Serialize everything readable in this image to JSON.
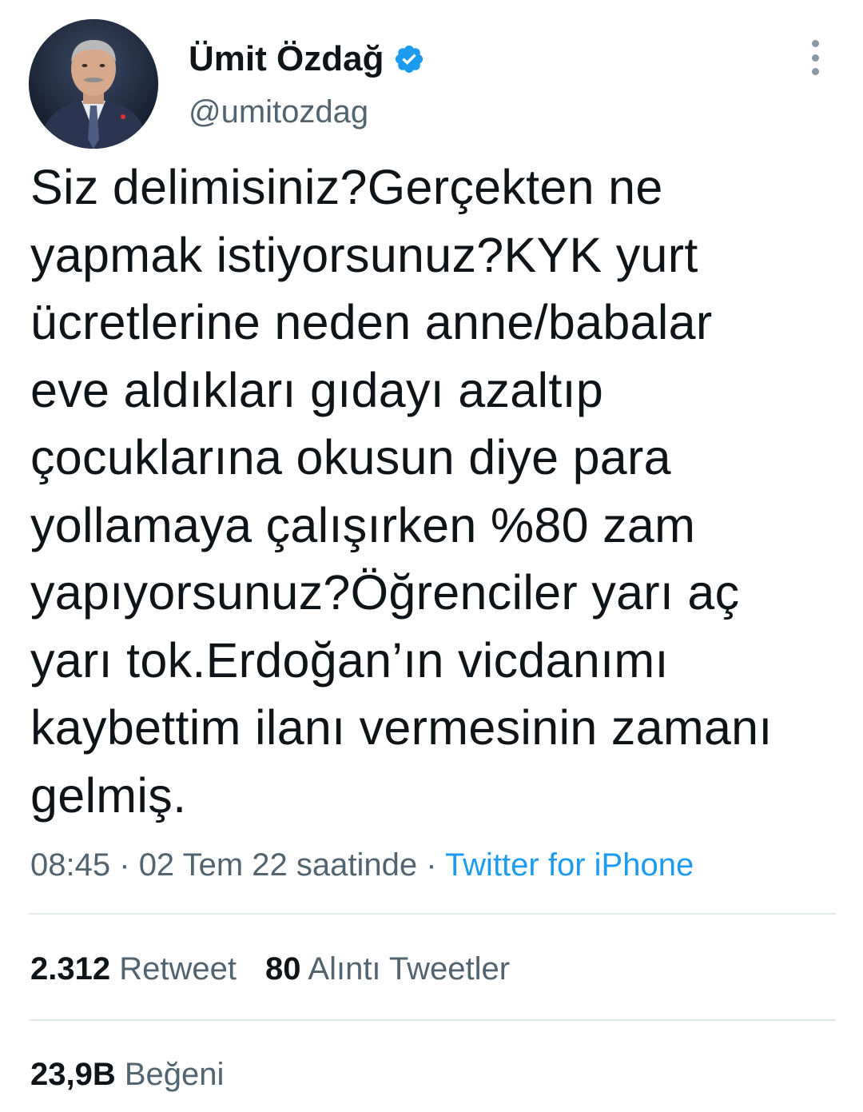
{
  "author": {
    "name": "Ümit Özdağ",
    "handle": "@umitozdag",
    "verified": true,
    "avatar_icon": "profile-photo"
  },
  "tweet": {
    "text": "Siz delimisiniz?Gerçekten ne\nyapmak istiyorsunuz?KYK yurt\nücretlerine neden anne/babalar\neve aldıkları gıdayı azaltıp\nçocuklarına okusun diye para\nyollamaya çalışırken %80 zam\nyapıyorsunuz?Öğrenciler yarı aç\nyarı tok.Erdoğan’ın vicdanımı\nkaybettim ilanı vermesinin zamanı\ngelmiş.",
    "time": "08:45",
    "date": "02 Tem 22 saatinde",
    "separator": "·",
    "source": "Twitter for iPhone"
  },
  "stats": {
    "retweets_count": "2.312",
    "retweets_label": "Retweet",
    "quotes_count": "80",
    "quotes_label": "Alıntı Tweetler",
    "likes_count": "23,9B",
    "likes_label": "Beğeni"
  },
  "colors": {
    "text": "#0f1419",
    "secondary": "#536471",
    "link": "#1d9bf0",
    "divider": "#e3e8eb",
    "verified_badge": "#1d9bf0"
  }
}
